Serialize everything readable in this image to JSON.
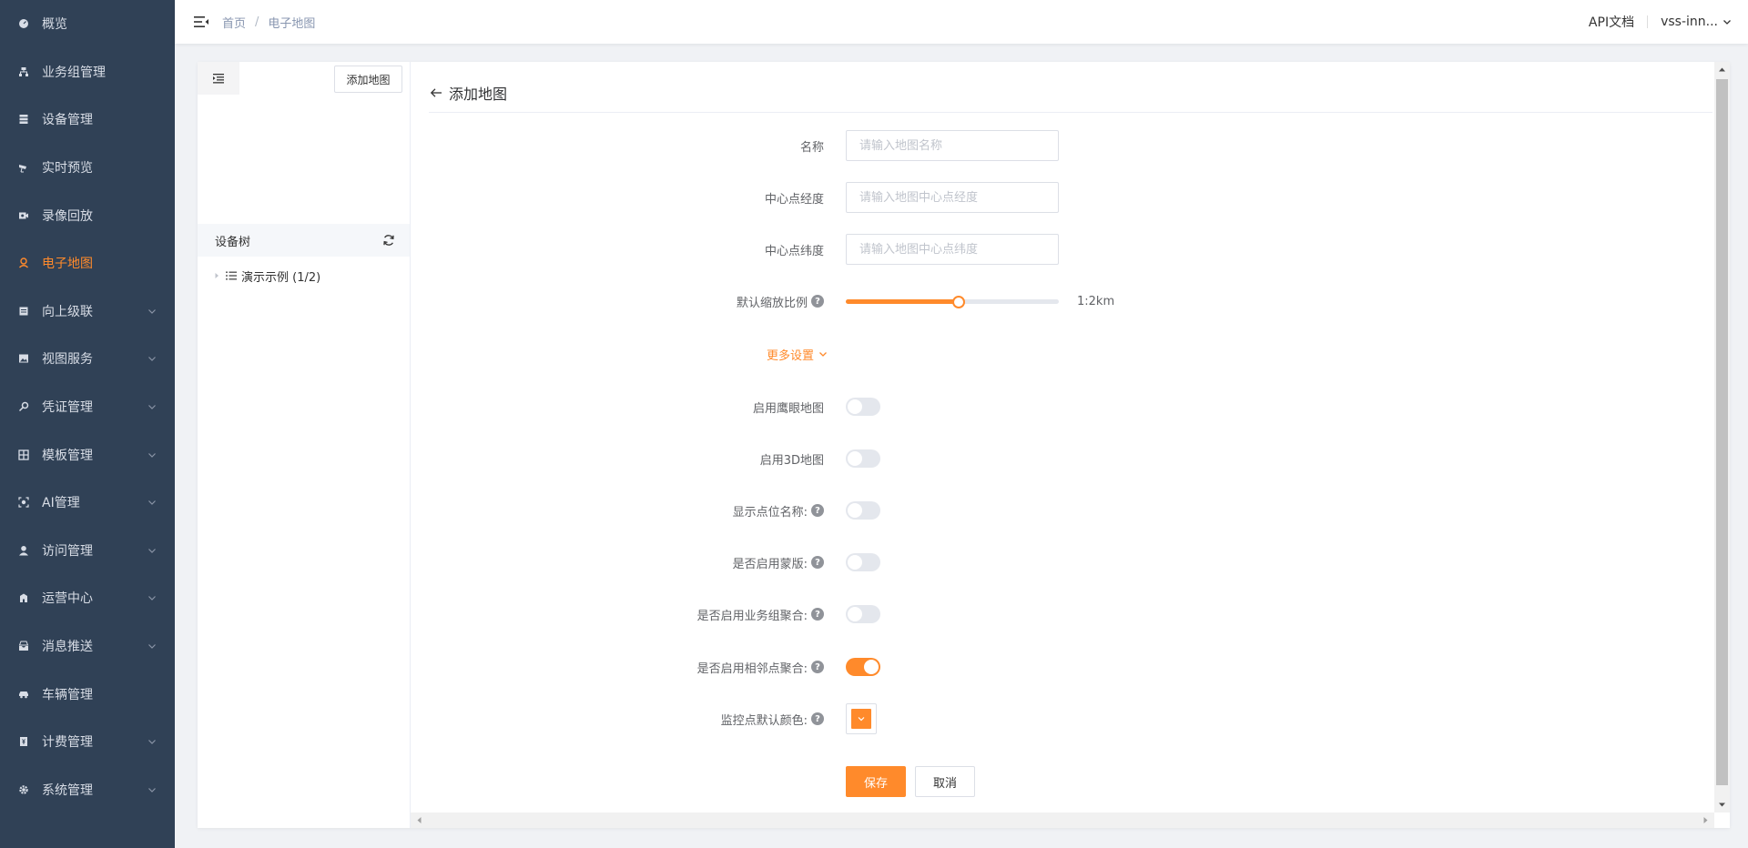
{
  "colors": {
    "accent": "#ff8a2b",
    "sidebar_bg": "#304156",
    "marker_color": "#ff8a2b"
  },
  "sidebar": {
    "items": [
      {
        "label": "概览",
        "icon": "dashboard-icon",
        "active": false,
        "expandable": false
      },
      {
        "label": "业务组管理",
        "icon": "org-icon",
        "active": false,
        "expandable": false
      },
      {
        "label": "设备管理",
        "icon": "server-icon",
        "active": false,
        "expandable": false
      },
      {
        "label": "实时预览",
        "icon": "camera-icon",
        "active": false,
        "expandable": false
      },
      {
        "label": "录像回放",
        "icon": "video-icon",
        "active": false,
        "expandable": false
      },
      {
        "label": "电子地图",
        "icon": "map-pin-icon",
        "active": true,
        "expandable": false
      },
      {
        "label": "向上级联",
        "icon": "cascade-icon",
        "active": false,
        "expandable": true
      },
      {
        "label": "视图服务",
        "icon": "image-icon",
        "active": false,
        "expandable": true
      },
      {
        "label": "凭证管理",
        "icon": "key-icon",
        "active": false,
        "expandable": true
      },
      {
        "label": "模板管理",
        "icon": "grid-icon",
        "active": false,
        "expandable": true
      },
      {
        "label": "AI管理",
        "icon": "ai-icon",
        "active": false,
        "expandable": true
      },
      {
        "label": "访问管理",
        "icon": "user-icon",
        "active": false,
        "expandable": true
      },
      {
        "label": "运营中心",
        "icon": "building-icon",
        "active": false,
        "expandable": true
      },
      {
        "label": "消息推送",
        "icon": "inbox-icon",
        "active": false,
        "expandable": true
      },
      {
        "label": "车辆管理",
        "icon": "car-icon",
        "active": false,
        "expandable": false
      },
      {
        "label": "计费管理",
        "icon": "billing-icon",
        "active": false,
        "expandable": true
      },
      {
        "label": "系统管理",
        "icon": "gear-icon",
        "active": false,
        "expandable": true
      }
    ]
  },
  "header": {
    "breadcrumb": [
      "首页",
      "电子地图"
    ],
    "breadcrumb_sep": "/",
    "api_docs": "API文档",
    "user": "vss-inn..."
  },
  "left_panel": {
    "add_map_button": "添加地图",
    "tree_title": "设备树",
    "tree_node": "演示示例 (1/2)"
  },
  "form": {
    "title": "添加地图",
    "name": {
      "label": "名称",
      "placeholder": "请输入地图名称",
      "value": ""
    },
    "center_lng": {
      "label": "中心点经度",
      "placeholder": "请输入地图中心点经度",
      "value": ""
    },
    "center_lat": {
      "label": "中心点纬度",
      "placeholder": "请输入地图中心点纬度",
      "value": ""
    },
    "zoom": {
      "label": "默认缩放比例",
      "value_text": "1:2km",
      "fraction": 0.53
    },
    "more_settings": "更多设置",
    "toggles": [
      {
        "label": "启用鹰眼地图",
        "help": false,
        "on": false
      },
      {
        "label": "启用3D地图",
        "help": false,
        "on": false
      },
      {
        "label": "显示点位名称:",
        "help": true,
        "on": false
      },
      {
        "label": "是否启用蒙版:",
        "help": true,
        "on": false
      },
      {
        "label": "是否启用业务组聚合:",
        "help": true,
        "on": false
      },
      {
        "label": "是否启用相邻点聚合:",
        "help": true,
        "on": true
      }
    ],
    "marker_color": {
      "label": "监控点默认颜色:"
    },
    "help_glyph": "?",
    "save": "保存",
    "cancel": "取消"
  }
}
